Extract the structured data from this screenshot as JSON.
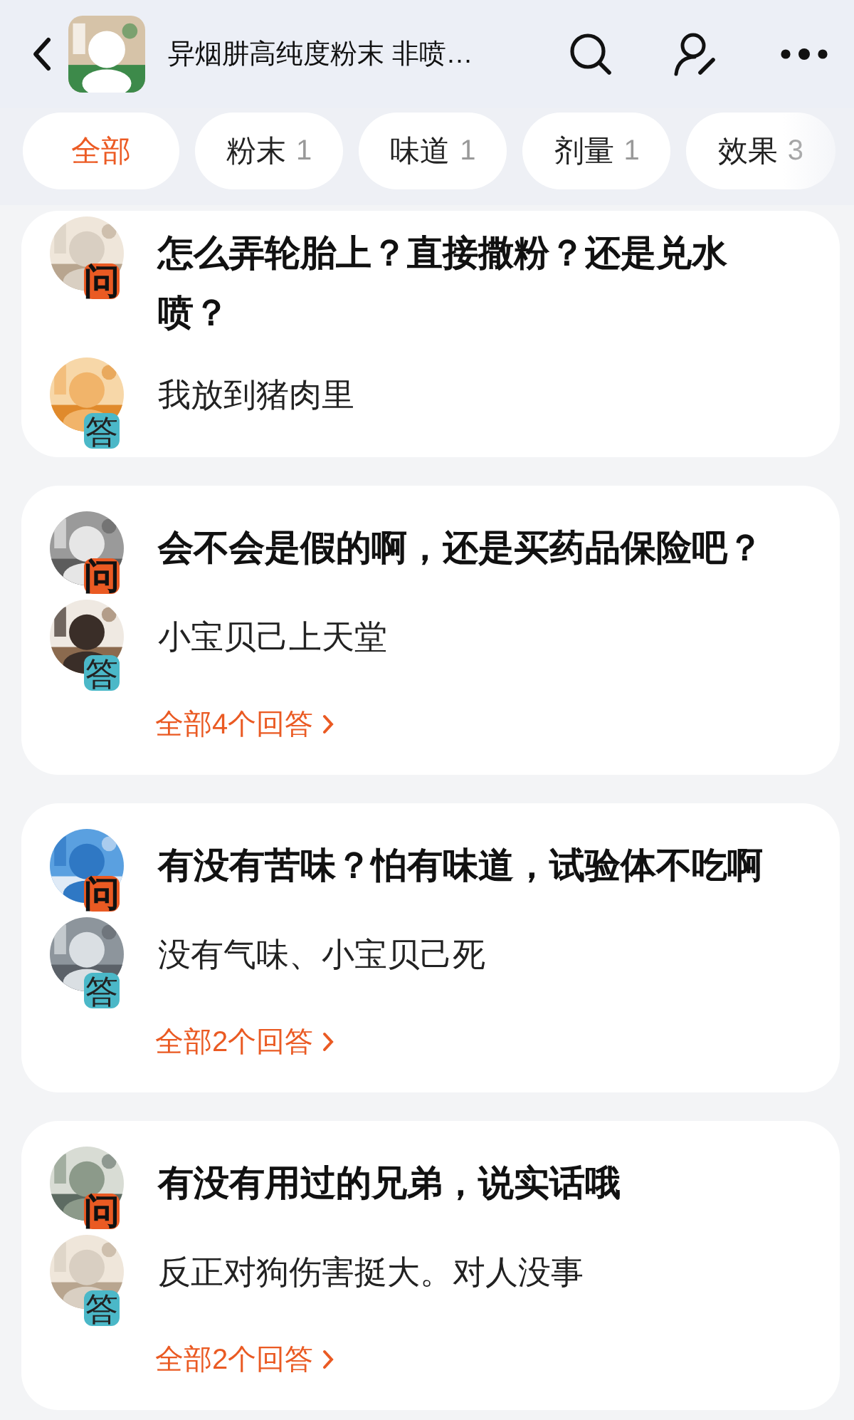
{
  "header": {
    "title": "异烟肼高纯度粉末  非喷…"
  },
  "filters": [
    {
      "label": "全部",
      "selected": true
    },
    {
      "label": "粉末",
      "count": "1",
      "selected": false
    },
    {
      "label": "味道",
      "count": "1",
      "selected": false
    },
    {
      "label": "剂量",
      "count": "1",
      "selected": false
    },
    {
      "label": "效果",
      "count": "3",
      "selected": false
    }
  ],
  "questions": [
    {
      "question": {
        "badge": "问",
        "text": "怎么弄轮胎上？直接撒粉？还是兑水喷？"
      },
      "answer": {
        "badge": "答",
        "text": "我放到猪肉里"
      }
    },
    {
      "question": {
        "badge": "问",
        "text": "会不会是假的啊，还是买药品保险吧？"
      },
      "answer": {
        "badge": "答",
        "text": "小宝贝己上天堂"
      },
      "more_link": "全部4个回答"
    },
    {
      "question": {
        "badge": "问",
        "text": "有没有苦味？怕有味道，试验体不吃啊"
      },
      "answer": {
        "badge": "答",
        "text": "没有气味、小宝贝己死"
      },
      "more_link": "全部2个回答"
    },
    {
      "question": {
        "badge": "问",
        "text": "有没有用过的兄弟，说实话哦"
      },
      "answer": {
        "badge": "答",
        "text": "反正对狗伤害挺大。对人没事"
      },
      "more_link": "全部2个回答"
    }
  ]
}
